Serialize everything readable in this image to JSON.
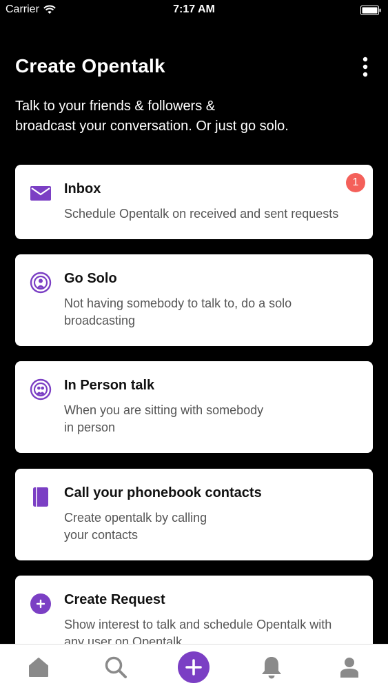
{
  "status_bar": {
    "carrier": "Carrier",
    "time": "7:17 AM"
  },
  "header": {
    "title": "Create Opentalk",
    "subtitle_line1": "Talk to your friends & followers &",
    "subtitle_line2": "broadcast your conversation. Or just go solo."
  },
  "cards": [
    {
      "title": "Inbox",
      "desc_line1": "Schedule Opentalk on received and sent requests",
      "desc_line2": "",
      "icon": "envelope-icon",
      "badge": "1"
    },
    {
      "title": "Go Solo",
      "desc_line1": "Not having somebody to talk to, do a solo",
      "desc_line2": "broadcasting",
      "icon": "broadcast-person-icon"
    },
    {
      "title": "In Person talk",
      "desc_line1": "When you are sitting with somebody",
      "desc_line2": "in person",
      "icon": "broadcast-group-icon"
    },
    {
      "title": "Call your phonebook contacts",
      "desc_line1": "Create opentalk by calling",
      "desc_line2": "your contacts",
      "icon": "phonebook-icon"
    },
    {
      "title": "Create Request",
      "desc_line1": "Show interest to talk and schedule Opentalk with",
      "desc_line2": "any user on Opentalk",
      "icon": "plus-circle-icon"
    }
  ],
  "colors": {
    "accent": "#7b3fc4",
    "badge": "#f4605a",
    "background": "#000000",
    "card": "#ffffff",
    "tab_icon": "#8a8a8a"
  },
  "tab_bar": {
    "tabs": [
      "home-icon",
      "search-icon",
      "create-icon",
      "notifications-icon",
      "profile-icon"
    ]
  }
}
